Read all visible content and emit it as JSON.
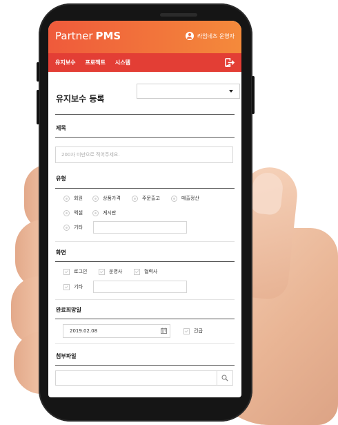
{
  "header": {
    "brand_light": "Partner",
    "brand_bold": "PMS",
    "user_label": "라임네츠 운영자"
  },
  "nav": {
    "items": [
      "유지보수",
      "프로젝트",
      "시스템"
    ]
  },
  "form": {
    "title": "유지보수 등록",
    "select_value": "",
    "subject": {
      "label": "제목",
      "placeholder": "200자 미만으로 적어주세요."
    },
    "type": {
      "label": "유형",
      "options": [
        "회원",
        "상품가격",
        "주문출고",
        "매출정산",
        "엑셀",
        "게시판",
        "기타"
      ]
    },
    "screen": {
      "label": "화면",
      "options": [
        "로그인",
        "운영사",
        "협력사",
        "기타"
      ]
    },
    "due_date": {
      "label": "완료희망일",
      "value": "2019.02.08",
      "urgent_label": "긴급"
    },
    "attachment": {
      "label": "첨부파일"
    }
  },
  "colors": {
    "header_start": "#ef5a3b",
    "header_end": "#f48a3b",
    "nav_bg": "#e33e35"
  },
  "icons": [
    "user-icon",
    "logout-icon",
    "chevron-down-icon",
    "calendar-icon",
    "search-icon"
  ]
}
